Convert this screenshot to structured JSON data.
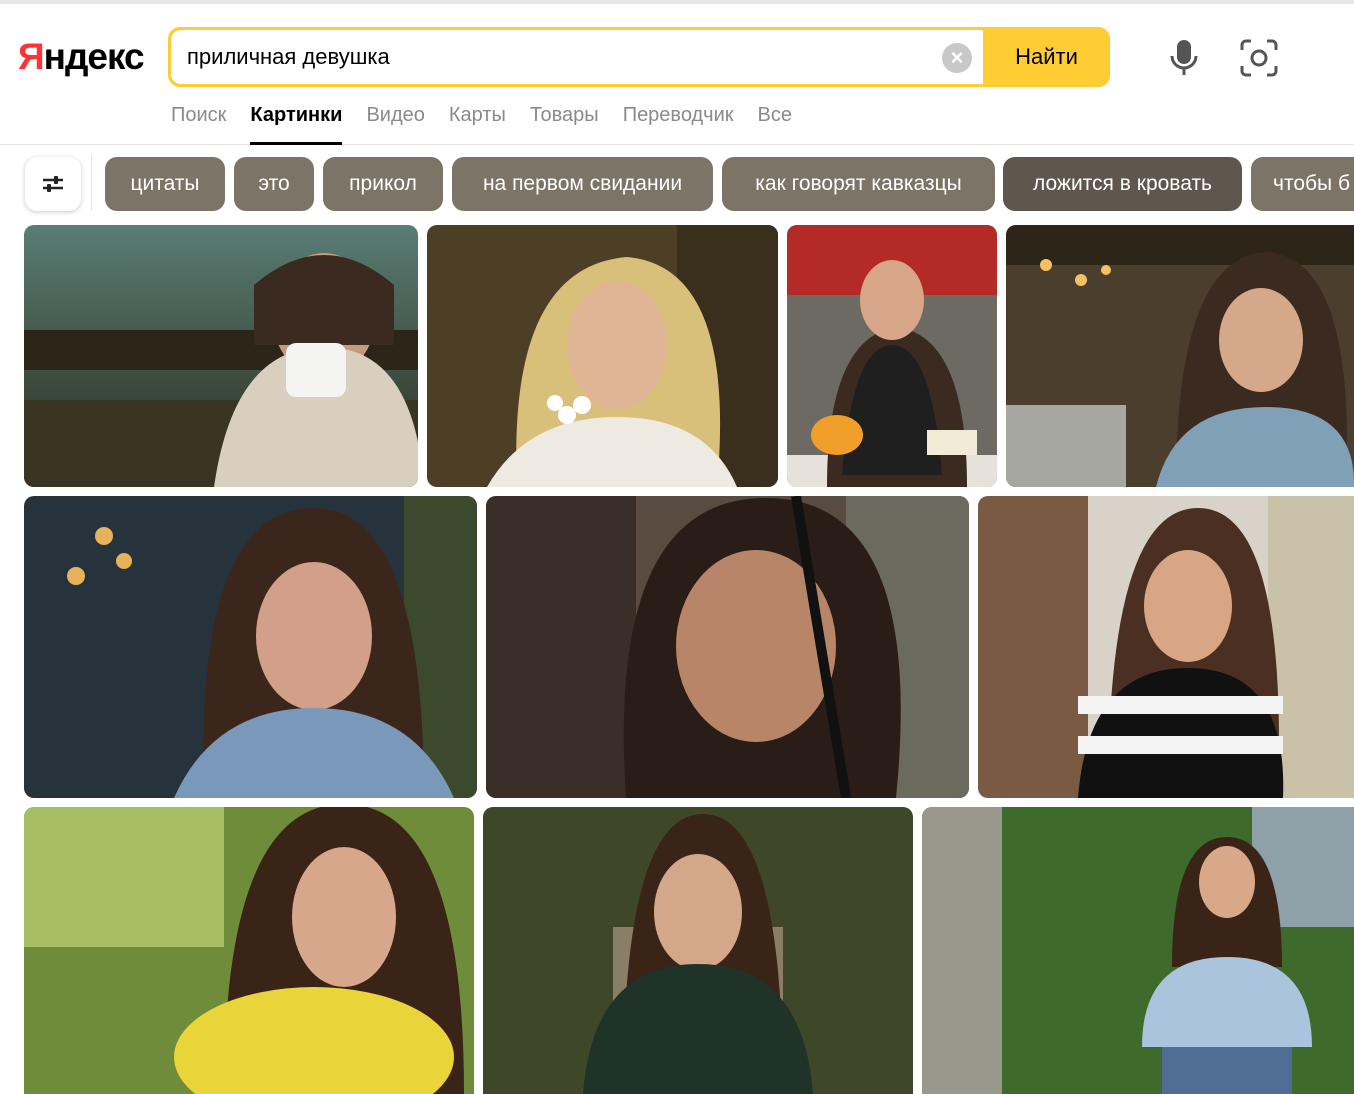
{
  "logo": {
    "first": "Я",
    "rest": "ндекс"
  },
  "search": {
    "value": "приличная девушка",
    "clear_symbol": "×",
    "button_label": "Найти"
  },
  "tabs": [
    {
      "label": "Поиск",
      "active": false
    },
    {
      "label": "Картинки",
      "active": true
    },
    {
      "label": "Видео",
      "active": false
    },
    {
      "label": "Карты",
      "active": false
    },
    {
      "label": "Товары",
      "active": false
    },
    {
      "label": "Переводчик",
      "active": false
    },
    {
      "label": "Все",
      "active": false
    }
  ],
  "chips": [
    {
      "label": "цитаты"
    },
    {
      "label": "это"
    },
    {
      "label": "прикол"
    },
    {
      "label": "на первом свидании"
    },
    {
      "label": "как говорят кавказцы"
    },
    {
      "label": "ложится в кровать"
    },
    {
      "label": "чтобы б"
    }
  ],
  "icons": {
    "microphone": "microphone-icon",
    "camera": "camera-search-icon",
    "filters": "filter-sliders-icon",
    "clear": "clear-icon"
  },
  "colors": {
    "brand_red": "#ff3333",
    "search_yellow": "#ffcc33",
    "chip": "#7c7467",
    "chip_active": "#5f574d"
  },
  "images": [
    {
      "subject": "woman with mug and scarf",
      "palette": [
        "#4a6b6d",
        "#9a8f79",
        "#2f3020"
      ]
    },
    {
      "subject": "blonde woman with daisies",
      "palette": [
        "#5b4a2c",
        "#d8c69a",
        "#2f2616"
      ]
    },
    {
      "subject": "woman at cafe with dessert",
      "palette": [
        "#b7302d",
        "#6b6b66",
        "#1f1f1f"
      ]
    },
    {
      "subject": "woman at street cafe",
      "palette": [
        "#4a3e2b",
        "#a98b6a",
        "#263040"
      ]
    },
    {
      "subject": "woman smiling at night street",
      "palette": [
        "#2c3a46",
        "#6e4d3b",
        "#1b2630"
      ]
    },
    {
      "subject": "woman with dark hair close-up",
      "palette": [
        "#5a4a3f",
        "#b08670",
        "#2a201c"
      ]
    },
    {
      "subject": "woman in striped top",
      "palette": [
        "#c9b9a6",
        "#7a5a43",
        "#e7e2dc"
      ]
    },
    {
      "subject": "woman with yellow flowers",
      "palette": [
        "#6d8a3a",
        "#e5d53a",
        "#3b2c23"
      ]
    },
    {
      "subject": "woman in green sweater",
      "palette": [
        "#3d4628",
        "#9a8d72",
        "#1e2a22"
      ]
    },
    {
      "subject": "woman in blue shirt",
      "palette": [
        "#3f6b2a",
        "#a9c2d6",
        "#7b7566"
      ]
    }
  ]
}
